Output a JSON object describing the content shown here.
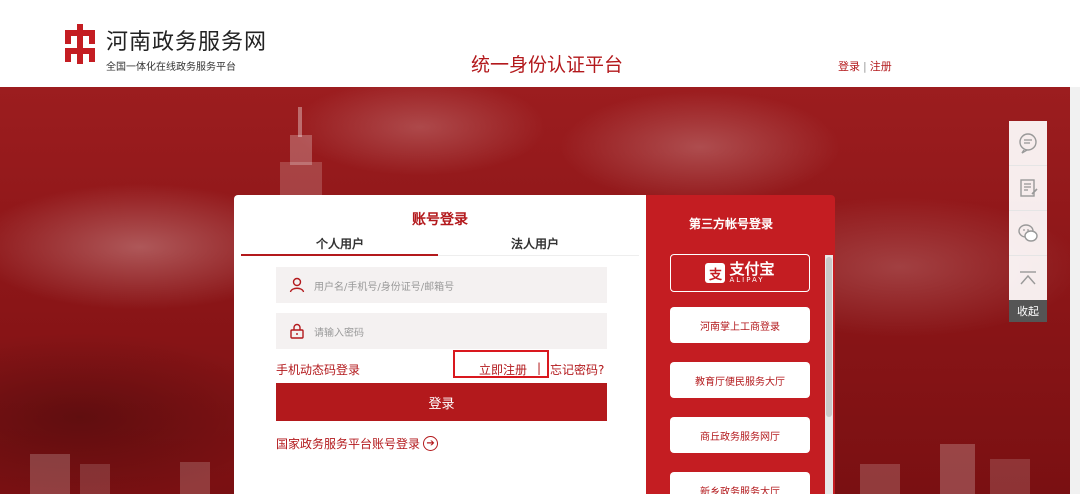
{
  "header": {
    "site_title": "河南政务服务网",
    "site_subtitle": "全国一体化在线政务服务平台",
    "platform_title": "统一身份认证平台",
    "login_link": "登录",
    "separator": "|",
    "register_link": "注册"
  },
  "login": {
    "title": "账号登录",
    "tabs": [
      {
        "label": "个人用户",
        "active": true
      },
      {
        "label": "法人用户",
        "active": false
      }
    ],
    "username_placeholder": "用户名/手机号/身份证号/邮箱号",
    "password_placeholder": "请输入密码",
    "sms_login": "手机动态码登录",
    "register_now": "立即注册",
    "link_separator": "|",
    "forgot_password": "忘记密码?",
    "login_button": "登录",
    "national_login": "国家政务服务平台账号登录"
  },
  "third_party": {
    "title": "第三方帐号登录",
    "alipay_cn": "支付宝",
    "alipay_en": "ALIPAY",
    "options": [
      "河南掌上工商登录",
      "教育厅便民服务大厅",
      "商丘政务服务网厅",
      "新乡政务服务大厅"
    ]
  },
  "sidebar": {
    "items": [
      "chat-icon",
      "edit-icon",
      "wechat-icon",
      "top-icon"
    ],
    "collapse_label": "收起"
  },
  "colors": {
    "brand_red": "#b3191c",
    "panel_red": "#c41d22",
    "highlight_border": "#d9181e"
  }
}
